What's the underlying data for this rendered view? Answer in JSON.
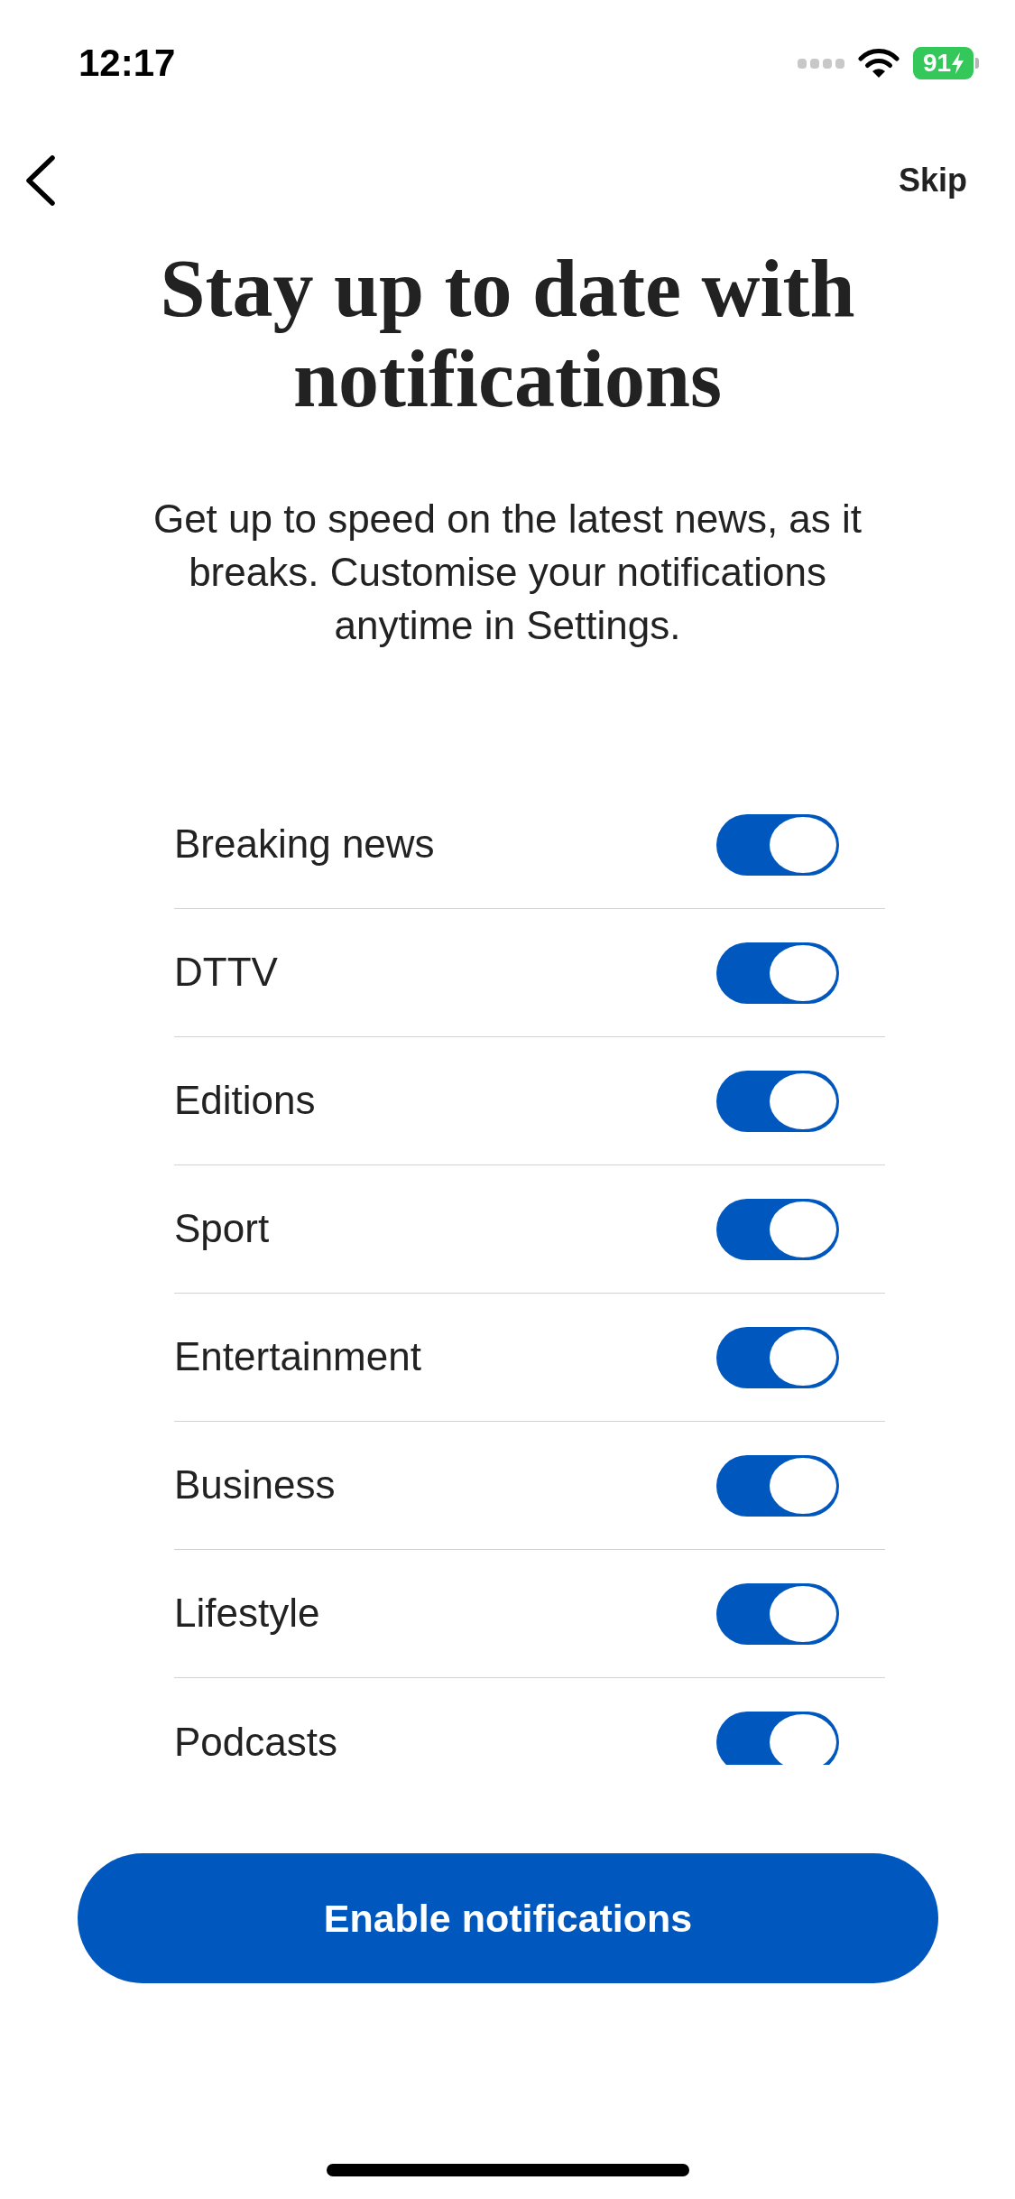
{
  "status_bar": {
    "time": "12:17",
    "battery": "91"
  },
  "nav": {
    "skip": "Skip"
  },
  "title": "Stay up to date with notifications",
  "description": "Get up to speed on the latest news, as it breaks. Customise your notifications anytime in Settings.",
  "toggles": [
    {
      "label": "Breaking news",
      "on": true
    },
    {
      "label": "DTTV",
      "on": true
    },
    {
      "label": "Editions",
      "on": true
    },
    {
      "label": "Sport",
      "on": true
    },
    {
      "label": "Entertainment",
      "on": true
    },
    {
      "label": "Business",
      "on": true
    },
    {
      "label": "Lifestyle",
      "on": true
    },
    {
      "label": "Podcasts",
      "on": true
    }
  ],
  "primary_button": "Enable notifications"
}
